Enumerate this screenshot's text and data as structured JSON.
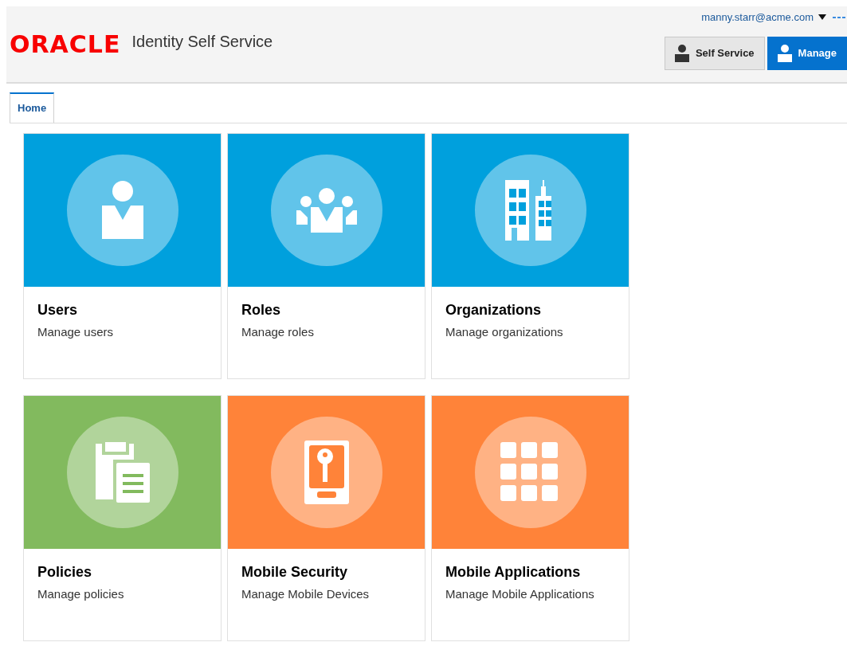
{
  "header": {
    "logo": "ORACLE",
    "product": "Identity Self Service",
    "user": "manny.starr@acme.com",
    "buttons": [
      {
        "label": "Self Service",
        "selected": false
      },
      {
        "label": "Manage",
        "selected": true
      }
    ]
  },
  "tabs": [
    {
      "label": "Home",
      "selected": true
    }
  ],
  "tiles": [
    {
      "title": "Users",
      "subtitle": "Manage users",
      "color": "#00a0dd",
      "kind": "user"
    },
    {
      "title": "Roles",
      "subtitle": "Manage roles",
      "color": "#00a0dd",
      "kind": "group"
    },
    {
      "title": "Organizations",
      "subtitle": "Manage organizations",
      "color": "#00a0dd",
      "kind": "building"
    },
    {
      "title": "Policies",
      "subtitle": "Manage policies",
      "color": "#82ba5e",
      "kind": "document"
    },
    {
      "title": "Mobile Security",
      "subtitle": "Manage Mobile Devices",
      "color": "#ff8339",
      "kind": "phone-key"
    },
    {
      "title": "Mobile Applications",
      "subtitle": "Manage Mobile Applications",
      "color": "#ff8339",
      "kind": "apps"
    }
  ]
}
